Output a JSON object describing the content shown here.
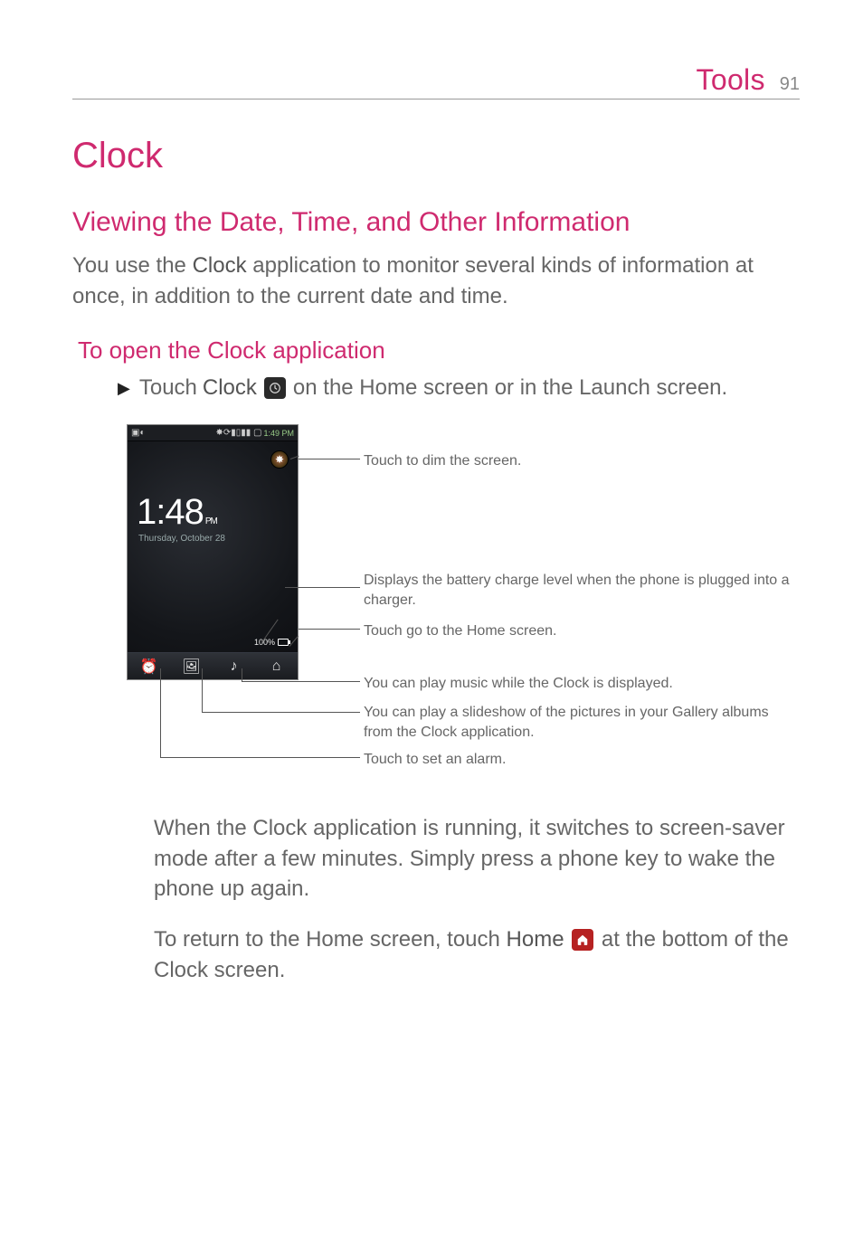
{
  "header": {
    "section": "Tools",
    "page_number": "91"
  },
  "title": "Clock",
  "subheading": "Viewing the Date, Time, and Other Information",
  "intro": "You use the Clock application to monitor several kinds of information at once, in addition to the current date and time.",
  "step_head": "To open the Clock application",
  "step": {
    "prefix": "Touch ",
    "bold1": "Clock",
    "suffix": " on the Home screen or in the Launch screen."
  },
  "device": {
    "status_left_glyphs": "▣◐",
    "status_right_glyphs": "✸⟳▮▯▮▮ ▢",
    "status_time": "1:49 PM",
    "time": "1:48",
    "ampm": "PM",
    "date": "Thursday, October 28",
    "charge": "100%",
    "dock": {
      "alarm": "⏰",
      "slideshow": "🖼",
      "music": "♪",
      "home": "⌂"
    }
  },
  "callouts": {
    "dim": "Touch to dim the screen.",
    "battery": "Displays the battery charge level when the phone is plugged into a charger.",
    "home": "Touch go to the Home screen.",
    "music": "You can play music while the Clock is displayed.",
    "slideshow": "You can play a slideshow of the pictures in your Gallery albums from the Clock application.",
    "alarm": "Touch to set an alarm."
  },
  "para1": "When the Clock application is running, it switches to screen-saver mode after a few minutes. Simply press a phone key to wake the phone up again.",
  "para2": {
    "a": "To return to the Home screen, touch ",
    "bold": "Home",
    "b": " at the bottom of the Clock screen."
  }
}
